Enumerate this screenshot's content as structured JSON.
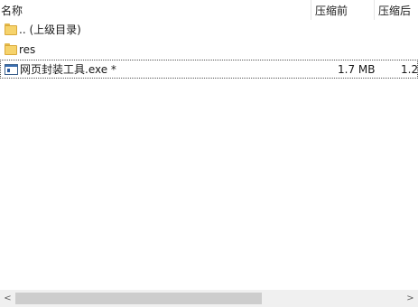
{
  "columns": {
    "name": "名称",
    "compressed_before": "压缩前",
    "compressed_after": "压缩后"
  },
  "rows": [
    {
      "icon": "folder-up-icon",
      "name": ".. (上级目录)",
      "size_before": "",
      "size_after": ""
    },
    {
      "icon": "folder-icon",
      "name": "res",
      "size_before": "",
      "size_after": ""
    },
    {
      "icon": "exe-file-icon",
      "name": "网页封装工具.exe *",
      "size_before": "1.7 MB",
      "size_after": "1.2"
    }
  ],
  "scrollbar": {
    "left_arrow": "<",
    "right_arrow": ">"
  }
}
